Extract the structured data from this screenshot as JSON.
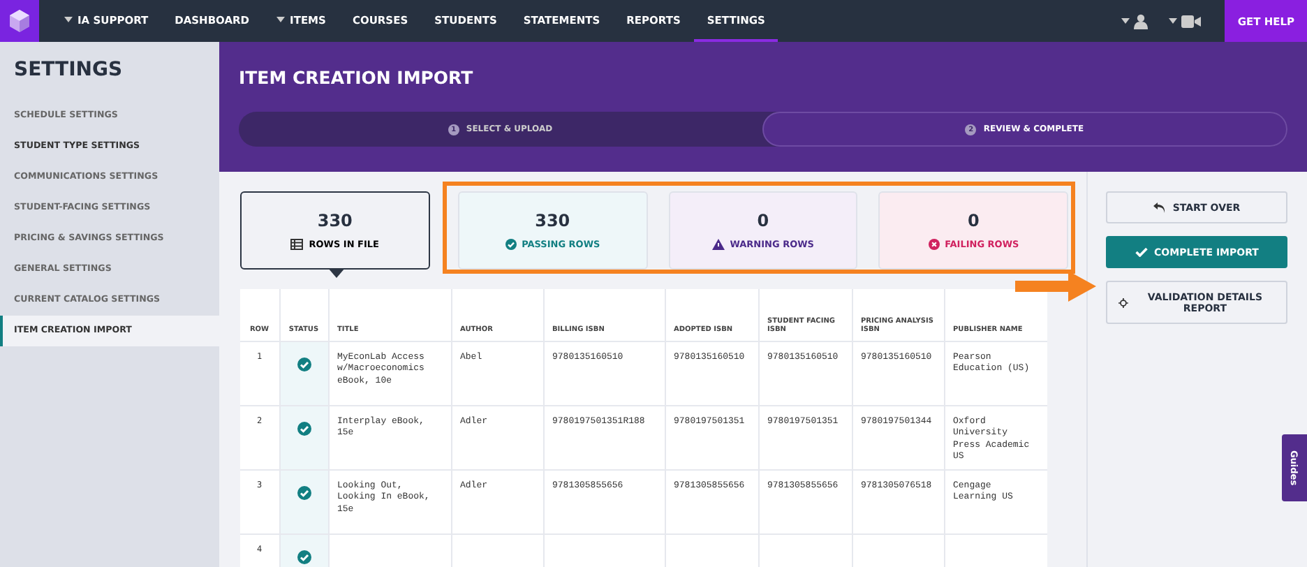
{
  "nav": {
    "items": [
      {
        "label": "IA SUPPORT",
        "dropdown": true,
        "selected": false
      },
      {
        "label": "DASHBOARD",
        "dropdown": false,
        "selected": false
      },
      {
        "label": "ITEMS",
        "dropdown": true,
        "selected": false
      },
      {
        "label": "COURSES",
        "dropdown": false,
        "selected": false
      },
      {
        "label": "STUDENTS",
        "dropdown": false,
        "selected": false
      },
      {
        "label": "STATEMENTS",
        "dropdown": false,
        "selected": false
      },
      {
        "label": "REPORTS",
        "dropdown": false,
        "selected": false
      },
      {
        "label": "SETTINGS",
        "dropdown": false,
        "selected": true
      }
    ],
    "help": "GET HELP"
  },
  "sidebar": {
    "title": "SETTINGS",
    "items": [
      {
        "label": "SCHEDULE SETTINGS",
        "selected": false
      },
      {
        "label": "STUDENT TYPE SETTINGS",
        "selected": false
      },
      {
        "label": "COMMUNICATIONS SETTINGS",
        "selected": false
      },
      {
        "label": "STUDENT-FACING SETTINGS",
        "selected": false
      },
      {
        "label": "PRICING & SAVINGS SETTINGS",
        "selected": false
      },
      {
        "label": "GENERAL SETTINGS",
        "selected": false
      },
      {
        "label": "CURRENT CATALOG SETTINGS",
        "selected": false
      },
      {
        "label": "ITEM CREATION IMPORT",
        "selected": true
      }
    ]
  },
  "page_title": "ITEM CREATION IMPORT",
  "steps": [
    {
      "number": "1",
      "label": "SELECT & UPLOAD",
      "selected": false
    },
    {
      "number": "2",
      "label": "REVIEW & COMPLETE",
      "selected": true
    }
  ],
  "summary": [
    {
      "kind": "total",
      "count": "330",
      "label": "ROWS IN FILE",
      "selected": true
    },
    {
      "kind": "passing",
      "count": "330",
      "label": "PASSING ROWS",
      "selected": false
    },
    {
      "kind": "warning",
      "count": "0",
      "label": "WARNING ROWS",
      "selected": false
    },
    {
      "kind": "failing",
      "count": "0",
      "label": "FAILING ROWS",
      "selected": false
    }
  ],
  "table": {
    "columns": [
      "ROW",
      "STATUS",
      "TITLE",
      "AUTHOR",
      "BILLING ISBN",
      "ADOPTED ISBN",
      "STUDENT FACING ISBN",
      "PRICING ANALYSIS ISBN",
      "PUBLISHER NAME"
    ],
    "rows": [
      {
        "passing": true,
        "cells": [
          "1",
          "",
          "MyEconLab Access w/Macroeconomics eBook, 10e",
          "Abel",
          "9780135160510",
          "9780135160510",
          "9780135160510",
          "9780135160510",
          "Pearson Education (US)"
        ]
      },
      {
        "passing": true,
        "cells": [
          "2",
          "",
          "Interplay eBook, 15e",
          "Adler",
          "9780197501351R188",
          "9780197501351",
          "9780197501351",
          "9780197501344",
          "Oxford University Press Academic US"
        ]
      },
      {
        "passing": true,
        "cells": [
          "3",
          "",
          "Looking Out, Looking In eBook, 15e",
          "Adler",
          "9781305855656",
          "9781305855656",
          "9781305855656",
          "9781305076518",
          "Cengage Learning US"
        ]
      },
      {
        "passing": true,
        "cells": [
          "4",
          ""
        ]
      }
    ]
  },
  "actions": [
    {
      "kind": "outline",
      "label": "START OVER"
    },
    {
      "kind": "primary",
      "label": "COMPLETE IMPORT"
    },
    {
      "kind": "outline",
      "label": "VALIDATION DETAILS REPORT"
    }
  ],
  "guides": "Guides"
}
